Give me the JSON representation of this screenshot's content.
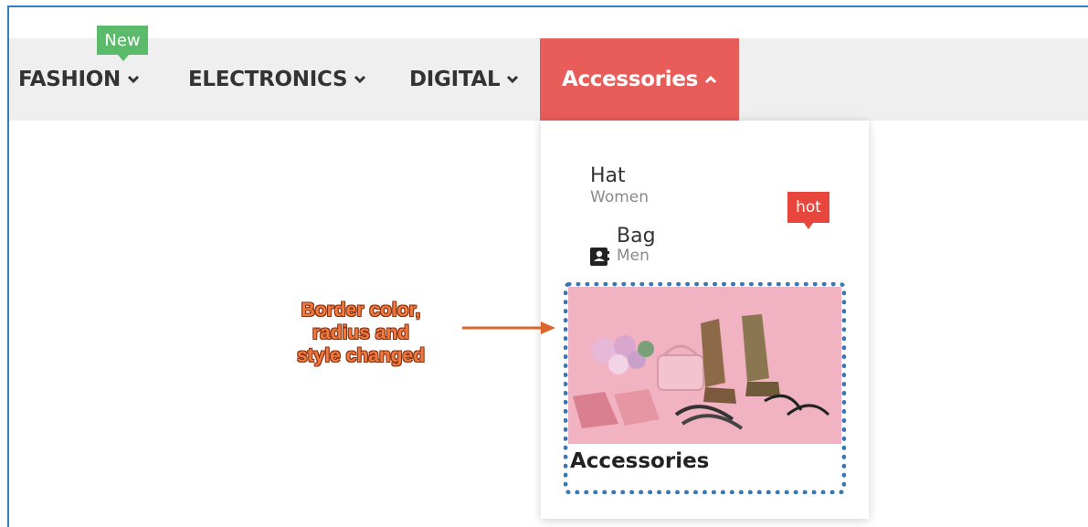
{
  "nav": {
    "items": [
      {
        "label": "FASHION"
      },
      {
        "label": "ELECTRONICS"
      },
      {
        "label": "DIGITAL"
      },
      {
        "label": "Accessories"
      }
    ],
    "new_badge": "New",
    "active_color": "#e85c5a"
  },
  "dropdown": {
    "items": [
      {
        "title": "Hat",
        "subtitle": "Women"
      },
      {
        "title": "Bag",
        "subtitle": "Men"
      }
    ],
    "hot_badge": "hot",
    "promo": {
      "caption": "Accessories",
      "border_color": "#3a78b5",
      "border_style": "dotted"
    }
  },
  "annotation": {
    "lines": [
      "Border color,",
      "radius and",
      "style changed"
    ],
    "color": "#ef7a40"
  }
}
